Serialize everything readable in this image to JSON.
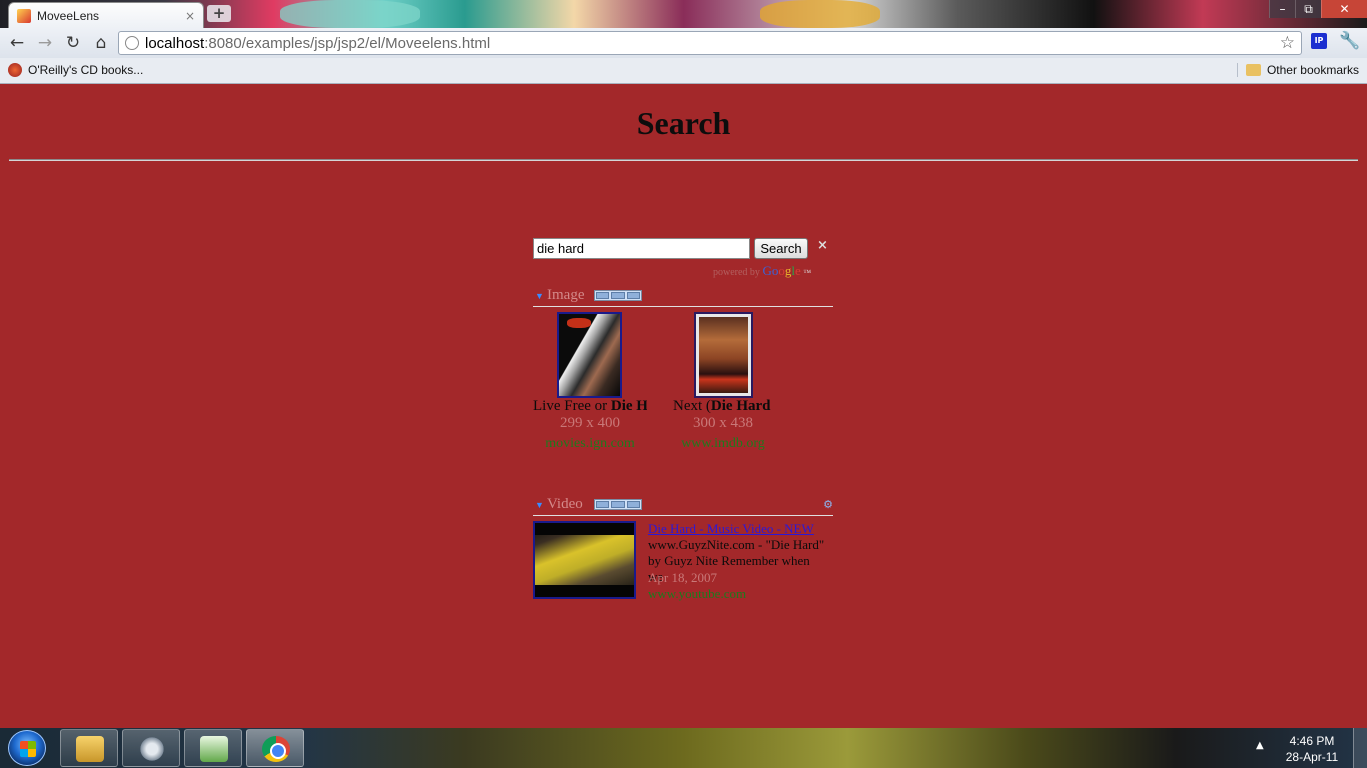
{
  "browser": {
    "tab_title": "MoveeLens",
    "tab_close": "×",
    "new_tab": "+",
    "window_buttons": {
      "minimize": "–",
      "restore": "⧉",
      "close": "✕"
    },
    "nav": {
      "back": "←",
      "forward": "→",
      "reload": "↻",
      "home": "⌂"
    },
    "url_host": "localhost",
    "url_rest": ":8080/examples/jsp/jsp2/el/Moveelens.html",
    "star": "☆",
    "ext_label": "IP",
    "wrench": "🔧",
    "bookmarks": {
      "left": "O'Reilly's CD books...",
      "right": "Other bookmarks"
    }
  },
  "page": {
    "heading": "Search",
    "search": {
      "query": "die hard",
      "button": "Search",
      "clear": "×"
    },
    "powered": {
      "prefix": "powered by",
      "g1": "Go",
      "g2": "o",
      "g3": "g",
      "g4": "l",
      "g5": "e",
      "tm": "™"
    },
    "image_section": {
      "label": "Image",
      "results": [
        {
          "title_plain": "Live Free or ",
          "title_bold": "Die H",
          "size": "299 x 400",
          "host": "movies.ign.com"
        },
        {
          "title_plain": "Next (",
          "title_bold": "Die Hard",
          "size": "300 x 438",
          "host": "www.imdb.org"
        }
      ]
    },
    "video_section": {
      "label": "Video",
      "gear": "⚙",
      "result": {
        "title": "Die Hard - Music Video - NEW",
        "desc": "www.GuyzNite.com - \"Die Hard\" by Guyz Nite Remember when we",
        "date": "Apr 18, 2007",
        "host": "www.youtube.com"
      }
    }
  },
  "taskbar": {
    "tray_arrow": "▲",
    "time": "4:46 PM",
    "date": "28-Apr-11"
  }
}
